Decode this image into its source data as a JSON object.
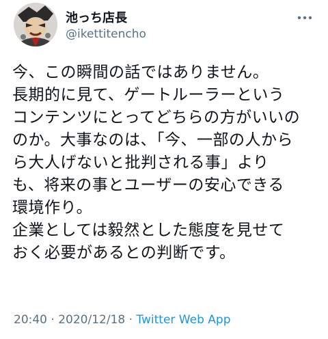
{
  "author": {
    "display_name": "池っち店長",
    "handle": "@ikettitencho"
  },
  "icons": {
    "more": "more-dots-icon",
    "avatar": "profile-avatar"
  },
  "tweet": {
    "lines": [
      "今、この瞬間の話ではありません。",
      "長期的に見て、ゲートルーラーという",
      "コンテンツにとってどちらの方がいいの",
      "のか。大事なのは、「今、一部の人から",
      "ら大人げないと批判される事」より",
      "も、将来の事とユーザーの安心できる",
      "環境作り。",
      "企業としては毅然とした態度を見せて",
      "おく必要があるとの判断です。"
    ]
  },
  "meta": {
    "time": "20:40",
    "separator1": " · ",
    "date": "2020/12/18",
    "separator2": " · ",
    "source": "Twitter Web App"
  },
  "colors": {
    "text": "#0f1419",
    "secondary": "#5b7083",
    "link": "#1b95e0"
  }
}
